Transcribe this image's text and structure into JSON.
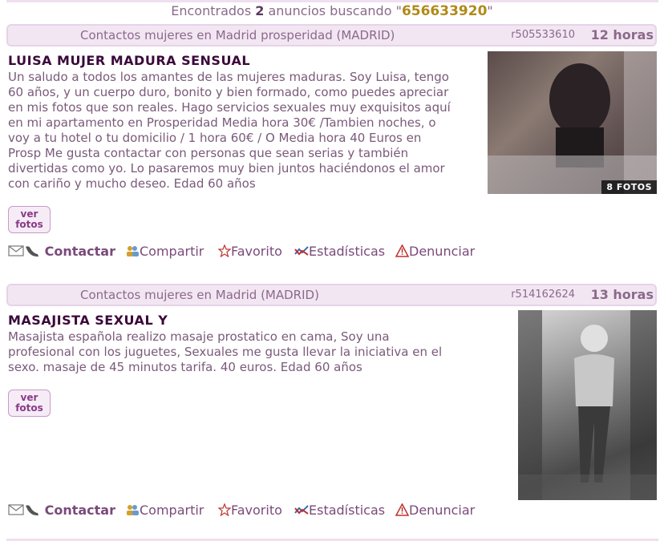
{
  "summary": {
    "prefix": "Encontrados",
    "count": "2",
    "middle": "anuncios buscando \"",
    "term": "656633920",
    "suffix": "\""
  },
  "ads": [
    {
      "category": "Contactos mujeres en Madrid prosperidad (MADRID)",
      "ref": "r505533610",
      "time": "12 horas",
      "title": "LUISA MUJER MADURA SENSUAL",
      "lines": [
        "Un saludo a todos los amantes de las mujeres maduras. Soy Luisa, tengo",
        "60 años, y un cuerpo duro, bonito y bien formado, como puedes apreciar",
        "en mis fotos que son reales. Hago servicios sexuales muy exquisitos aquí",
        "en mi apartamento en Prosperidad Media hora 30€ /Tambien noches, o",
        "voy a tu hotel o tu domicilio / 1 hora 60€ / O Media hora 40 Euros en",
        "Prosp Me gusta contactar con personas que sean serias y también",
        "divertidas como yo. Lo pasaremos muy bien juntos haciéndonos el amor",
        "con cariño y mucho deseo. Edad 60 años"
      ],
      "photo_count": "8 FOTOS",
      "ver_fotos": [
        "ver",
        "fotos"
      ]
    },
    {
      "category": "Contactos mujeres en Madrid (MADRID)",
      "ref": "r514162624",
      "time": "13 horas",
      "title": "MASAJISTA SEXUAL Y",
      "lines": [
        "Masajista española realizo masaje prostatico en cama, Soy una",
        "profesional con los juguetes, Sexuales me gusta llevar la iniciativa en el",
        "sexo. masaje de 45 minutos tarifa. 40 euros. Edad 60 años"
      ],
      "ver_fotos": [
        "ver",
        "fotos"
      ]
    }
  ],
  "actions": {
    "contact": "Contactar",
    "share": "Compartir",
    "favorite": "Favorito",
    "stats": "Estadísticas",
    "report": "Denunciar"
  }
}
